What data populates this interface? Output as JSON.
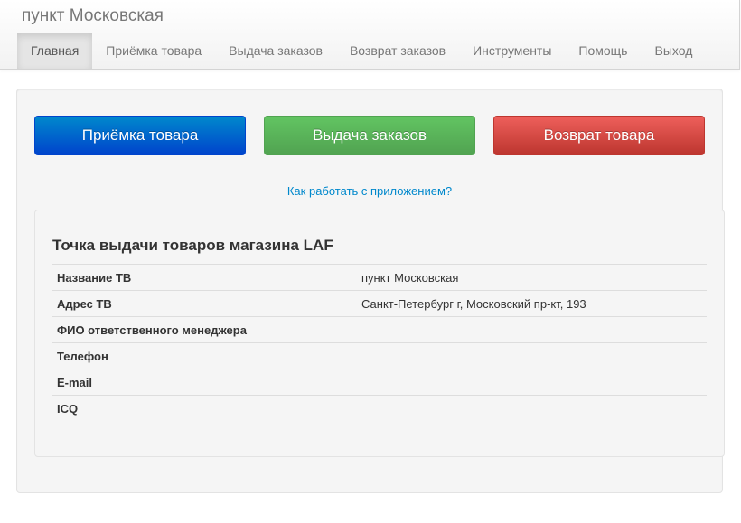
{
  "header": {
    "brand": "пункт Московская",
    "nav": [
      {
        "label": "Главная",
        "active": true
      },
      {
        "label": "Приёмка товара"
      },
      {
        "label": "Выдача заказов"
      },
      {
        "label": "Возврат заказов"
      },
      {
        "label": "Инструменты"
      },
      {
        "label": "Помощь"
      },
      {
        "label": "Выход"
      }
    ]
  },
  "actions": {
    "receive_label": "Приёмка товара",
    "issue_label": "Выдача заказов",
    "return_label": "Возврат товара"
  },
  "help_link": "Как работать с приложением?",
  "panel": {
    "title": "Точка выдачи товаров магазина LAF",
    "rows": [
      {
        "key": "Название ТВ",
        "value": "пункт Московская"
      },
      {
        "key": "Адрес ТВ",
        "value": "Санкт-Петербург г, Московский пр-кт, 193"
      },
      {
        "key": "ФИО ответственного менеджера",
        "value": ""
      },
      {
        "key": "Телефон",
        "value": ""
      },
      {
        "key": "E-mail",
        "value": ""
      },
      {
        "key": "ICQ",
        "value": ""
      }
    ]
  },
  "colors": {
    "primary": "#0055cc",
    "success": "#5bb75b",
    "danger": "#da4f49",
    "link": "#0088cc"
  }
}
